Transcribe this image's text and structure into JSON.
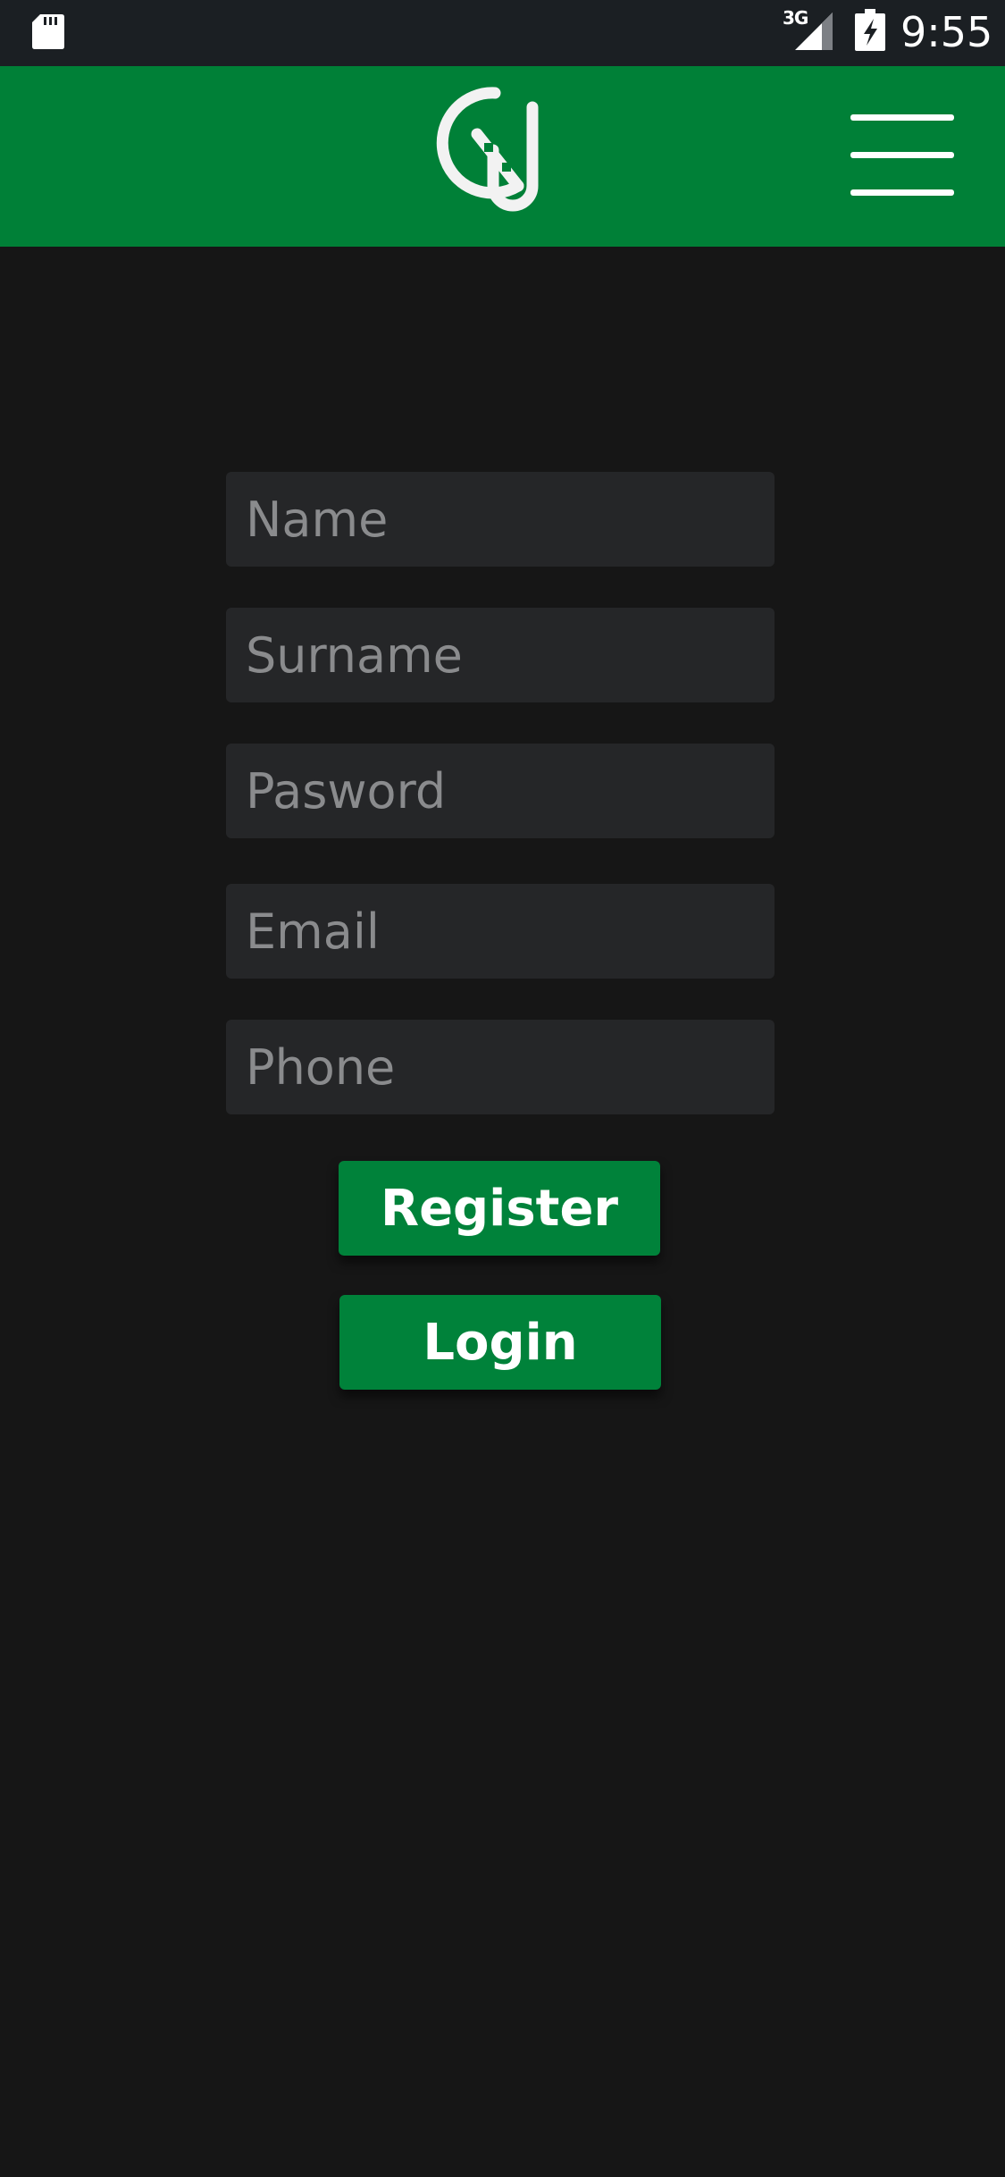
{
  "status_bar": {
    "network": "3G",
    "time": "9:55",
    "icons": [
      "sd-card-icon",
      "signal-icon",
      "battery-icon"
    ]
  },
  "header": {
    "logo": "logo-icon",
    "menu_icon": "hamburger-menu-icon",
    "background_color": "#008037"
  },
  "form": {
    "name_placeholder": "Name",
    "surname_placeholder": "Surname",
    "password_placeholder": "Pasword",
    "email_placeholder": "Email",
    "phone_placeholder": "Phone"
  },
  "buttons": {
    "register_label": "Register",
    "login_label": "Login",
    "color": "#00823a"
  }
}
